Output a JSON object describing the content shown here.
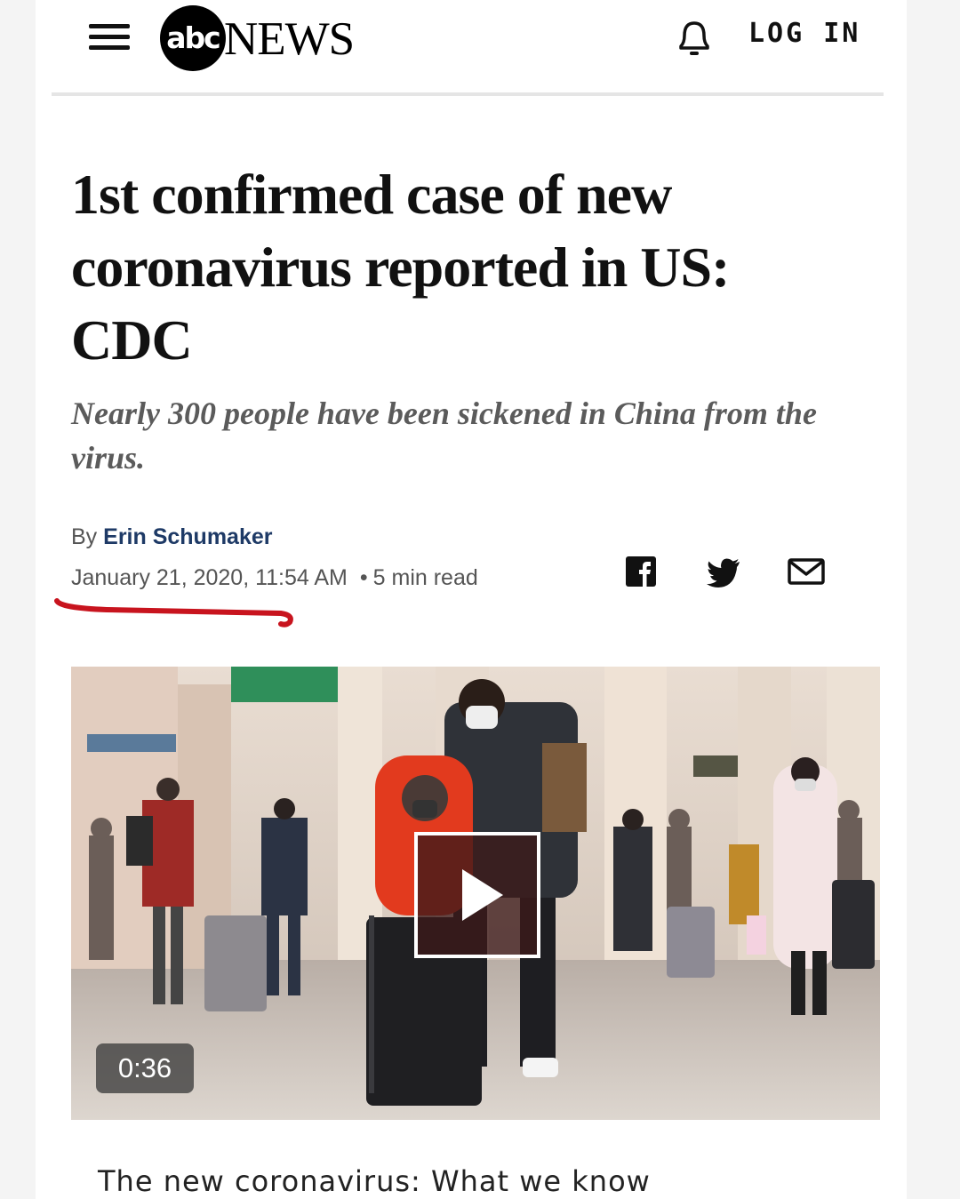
{
  "header": {
    "logo_mark": "abc",
    "logo_text": "NEWS",
    "login_label": "LOG IN"
  },
  "article": {
    "headline": "1st confirmed case of new coronavirus reported in US: CDC",
    "subhead": "Nearly 300 people have been sickened in China from the virus.",
    "byline_prefix": "By",
    "author": "Erin Schumaker",
    "date": "January 21, 2020, 11:54 AM",
    "separator": "•",
    "read_time": "5 min read"
  },
  "share": {
    "icons": [
      "facebook-icon",
      "twitter-icon",
      "email-icon"
    ]
  },
  "video": {
    "duration": "0:36",
    "caption": "The new coronavirus: What we know"
  },
  "colors": {
    "author": "#1e3a66",
    "annotation_underline": "#c8141e",
    "subhead": "#5b5b5b"
  }
}
